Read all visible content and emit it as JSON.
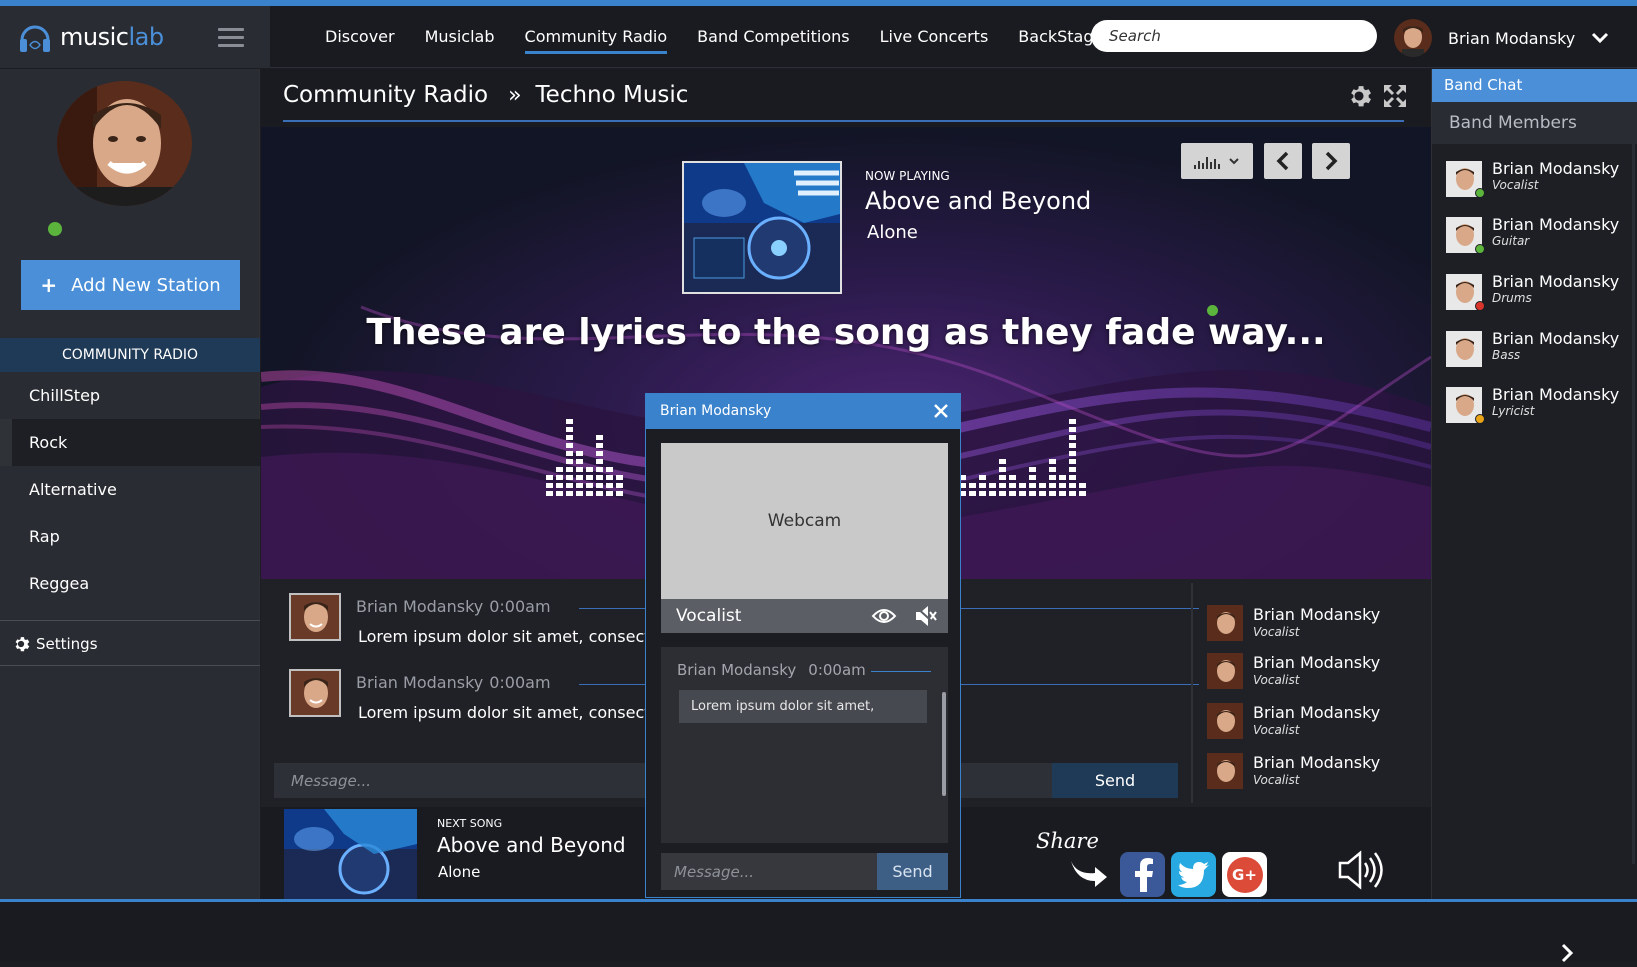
{
  "app": {
    "logo_main": "music",
    "logo_accent": "lab"
  },
  "nav": {
    "items": [
      "Discover",
      "Musiclab",
      "Community Radio",
      "Band Competitions",
      "Live Concerts",
      "BackStage"
    ],
    "search_placeholder": "Search",
    "user_name": "Brian Modansky"
  },
  "sidebar": {
    "add_station": "Add New Station",
    "section_title": "COMMUNITY RADIO",
    "stations": [
      "ChillStep",
      "Rock",
      "Alternative",
      "Rap",
      "Reggea"
    ],
    "active_station": "Rock",
    "settings": "Settings"
  },
  "breadcrumb": {
    "parent": "Community Radio",
    "separator": "»",
    "current": "Techno Music"
  },
  "now_playing": {
    "label": "NOW PLAYING",
    "artist": "Above and Beyond",
    "song": "Alone"
  },
  "lyrics": "These are lyrics to the song as they fade way...",
  "chat": {
    "messages": [
      {
        "user": "Brian Modansky",
        "time": "0:00am",
        "text": "Lorem ipsum dolor sit amet, consectetu"
      },
      {
        "user": "Brian Modansky",
        "time": "0:00am",
        "text": "Lorem ipsum dolor sit amet, consectetu"
      }
    ],
    "input_placeholder": "Message...",
    "send_label": "Send"
  },
  "listeners": [
    {
      "name": "Brian Modansky",
      "role": "Vocalist"
    },
    {
      "name": "Brian Modansky",
      "role": "Vocalist"
    },
    {
      "name": "Brian Modansky",
      "role": "Vocalist"
    },
    {
      "name": "Brian Modansky",
      "role": "Vocalist"
    }
  ],
  "next_song": {
    "label": "NEXT SONG",
    "artist": "Above and Beyond",
    "song": "Alone"
  },
  "share": {
    "label": "Share"
  },
  "band": {
    "chat_tab": "Band Chat",
    "members_title": "Band Members",
    "members": [
      {
        "name": "Brian Modansky",
        "role": "Vocalist",
        "status_color": "#5bb53c"
      },
      {
        "name": "Brian Modansky",
        "role": "Guitar",
        "status_color": "#5bb53c"
      },
      {
        "name": "Brian Modansky",
        "role": "Drums",
        "status_color": "#d9352b"
      },
      {
        "name": "Brian Modansky",
        "role": "Bass",
        "status_color": ""
      },
      {
        "name": "Brian Modansky",
        "role": "Lyricist",
        "status_color": "#e8a317"
      }
    ]
  },
  "popup": {
    "title": "Brian Modansky",
    "webcam_label": "Webcam",
    "cam_role": "Vocalist",
    "chat_user": "Brian Modansky",
    "chat_time": "0:00am",
    "chat_text": "Lorem ipsum dolor sit amet,",
    "input_placeholder": "Message...",
    "send_label": "Send"
  },
  "colors": {
    "accent": "#3a83cc",
    "button_blue": "#4a8fd8",
    "dark_blue": "#1f3a57",
    "online": "#5bb53c"
  }
}
